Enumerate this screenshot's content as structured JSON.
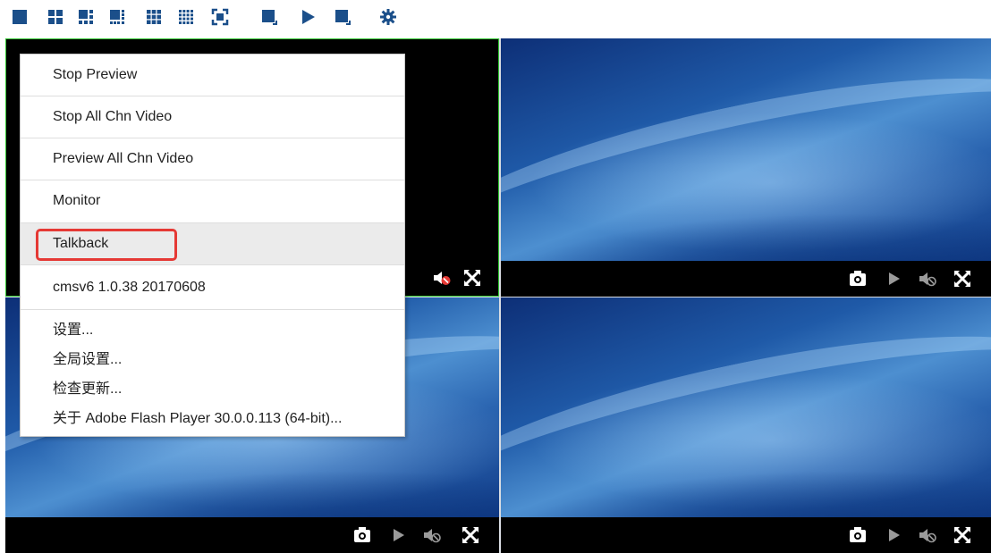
{
  "toolbar": {
    "buttons": [
      {
        "icon": "layout-1x1-icon"
      },
      {
        "icon": "layout-2x2-icon"
      },
      {
        "icon": "layout-1plus5-icon"
      },
      {
        "icon": "layout-1plus7-icon"
      },
      {
        "icon": "layout-3x3-icon"
      },
      {
        "icon": "layout-4x4-icon"
      },
      {
        "icon": "fullscreen-icon"
      },
      {
        "icon": "window-mode-icon"
      },
      {
        "icon": "play-all-icon"
      },
      {
        "icon": "stop-all-icon"
      },
      {
        "icon": "settings-gear-icon"
      }
    ],
    "icon_color": "#1b4f8a"
  },
  "video_tiles": [
    {
      "channel": 1,
      "state": "black",
      "selected": true
    },
    {
      "channel": 2,
      "state": "no-video-wallpaper"
    },
    {
      "channel": 3,
      "state": "no-video-wallpaper"
    },
    {
      "channel": 4,
      "state": "no-video-wallpaper"
    }
  ],
  "tile_controls": [
    "snapshot-icon",
    "play-icon",
    "audio-muted-icon",
    "expand-icon"
  ],
  "context_menu": {
    "items": [
      {
        "label": "Stop Preview"
      },
      {
        "label": "Stop All Chn Video"
      },
      {
        "label": "Preview All Chn Video"
      },
      {
        "label": "Monitor"
      },
      {
        "label": "Talkback",
        "hovered": true,
        "highlighted": true
      },
      {
        "label": "cmsv6 1.0.38 20170608"
      }
    ],
    "flash_items": [
      {
        "label": "设置..."
      },
      {
        "label": "全局设置..."
      },
      {
        "label": "检查更新..."
      },
      {
        "label": "关于 Adobe Flash Player 30.0.0.113 (64-bit)..."
      }
    ],
    "highlight_color": "#e53935"
  },
  "colors": {
    "selected_tile_border": "#32c832",
    "muted_badge": "#e53935"
  }
}
